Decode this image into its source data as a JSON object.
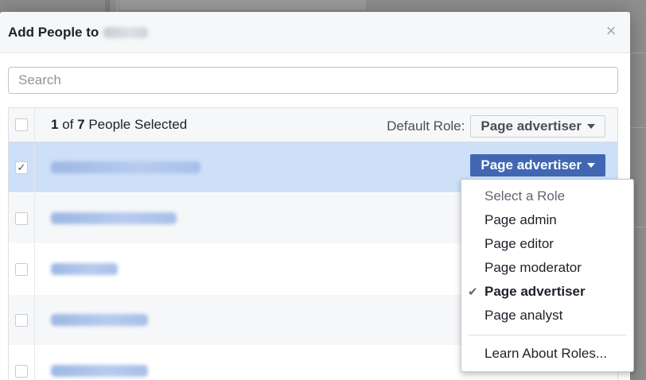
{
  "dialog": {
    "title": "Add People to",
    "close_glyph": "×"
  },
  "search": {
    "placeholder": "Search",
    "value": ""
  },
  "selection": {
    "selected_count": "1",
    "of_word": "of",
    "total_count": "7",
    "suffix": "People Selected"
  },
  "default_role": {
    "label": "Default Role:",
    "value": "Page advertiser"
  },
  "people": [
    {
      "checked": true,
      "role": "Page advertiser",
      "check_glyph": "✓"
    },
    {
      "checked": false
    },
    {
      "checked": false
    },
    {
      "checked": false
    },
    {
      "checked": false
    }
  ],
  "role_menu": {
    "header": "Select a Role",
    "items": [
      {
        "label": "Page admin",
        "checked": false
      },
      {
        "label": "Page editor",
        "checked": false
      },
      {
        "label": "Page moderator",
        "checked": false
      },
      {
        "label": "Page advertiser",
        "checked": true
      },
      {
        "label": "Page analyst",
        "checked": false
      }
    ],
    "check_glyph": "✔",
    "footer_link": "Learn About Roles..."
  },
  "colors": {
    "primary": "#4267b2",
    "selected_row": "#cde0f7",
    "header_bg": "#f6f7f9"
  }
}
